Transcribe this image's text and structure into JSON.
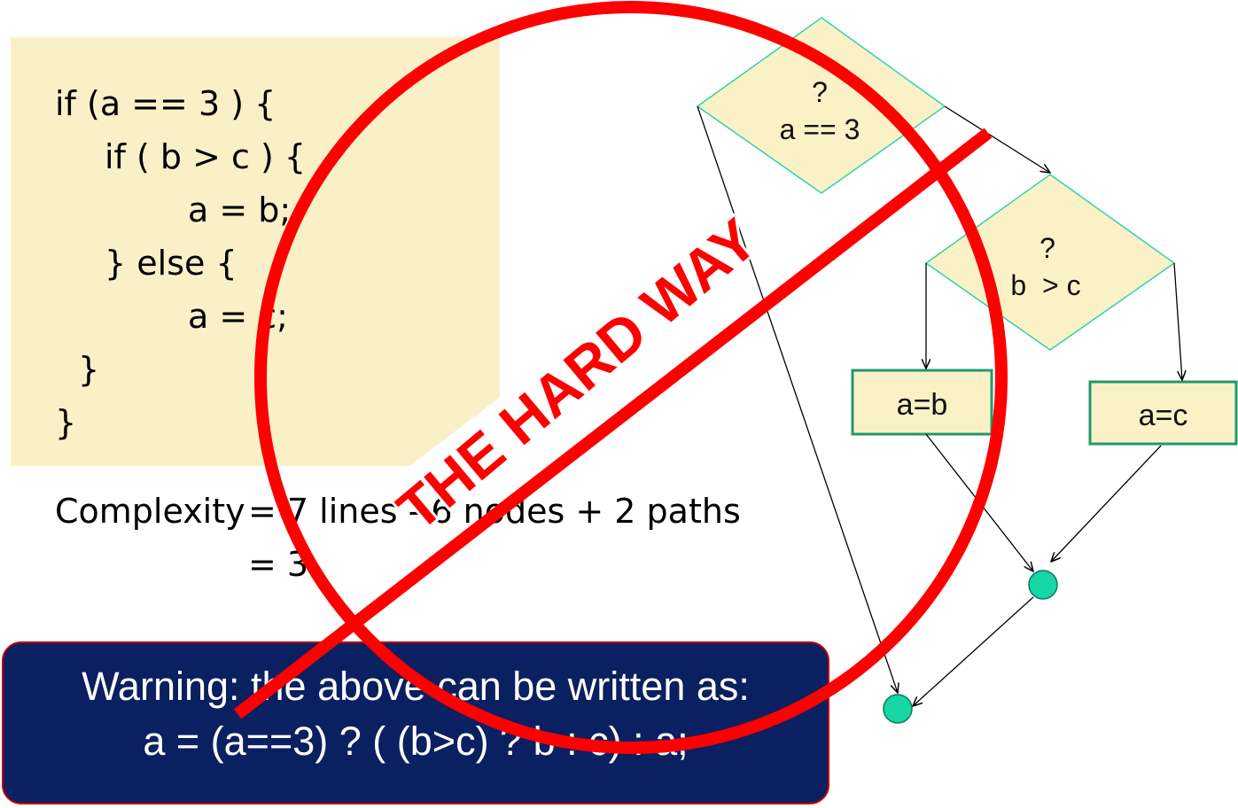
{
  "code": {
    "lines": [
      "if (a == 3 ) {",
      "if ( b > c ) {",
      "a = b;",
      "} else {",
      "a = c;",
      "}",
      "}"
    ]
  },
  "complexity": {
    "label": "Complexity",
    "line1": "= 7 lines - 6 nodes + 2 paths",
    "line2": "= 3"
  },
  "warning": {
    "line1": "Warning: the above can be written as:",
    "line2": "a = (a==3) ? ( (b>c) ? b : c) : a;"
  },
  "flowchart": {
    "decision1": {
      "mark": "?",
      "condition": "a == 3"
    },
    "decision2": {
      "mark": "?",
      "condition": "b  > c"
    },
    "action1": "a=b",
    "action2": "a=c"
  },
  "stamp": {
    "text": "THE HARD WAY",
    "color": "#ff0000"
  },
  "colors": {
    "code_background": "#faf0c8",
    "node_fill": "#fbf1c7",
    "node_border": "#2fd3b0",
    "box_border": "#1e9a6e",
    "merge_node": "#15d6a4",
    "warning_background": "#0b2060"
  }
}
